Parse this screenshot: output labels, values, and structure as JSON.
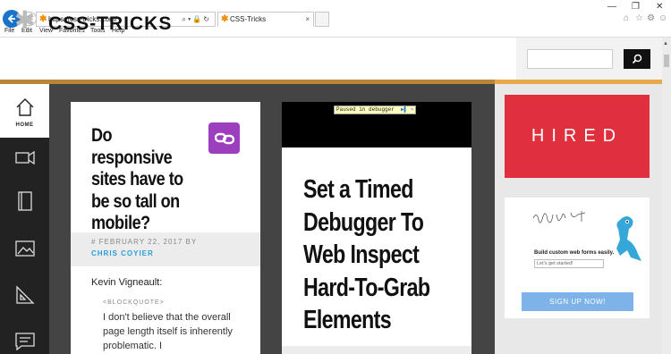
{
  "browser": {
    "url": "https://css-tricks.com/",
    "tab_title": "CSS-Tricks",
    "tab_close": "×",
    "menu": [
      "File",
      "Edit",
      "View",
      "Favorites",
      "Tools",
      "Help"
    ]
  },
  "site": {
    "title": "CSS-TRICKS",
    "home_label": "HOME",
    "search_placeholder": ""
  },
  "card1": {
    "title": "Do responsive sites have to be so tall on mobile?",
    "date": "# FEBRUARY 22, 2017 BY",
    "author": "CHRIS COYIER",
    "quote_author": "Kevin Vigneault:",
    "blockquote_tag": "<BLOCKQUOTE>",
    "blockquote_text": "I don't believe that the overall page length itself is inherently problematic. I"
  },
  "card2": {
    "debugger_badge": "Paused in debugger",
    "title_lines": [
      "Set a Timed",
      "Debugger To",
      "Web Inspect",
      "Hard-To-Grab",
      "Elements"
    ]
  },
  "ads": {
    "hired": "HIRED",
    "form_text": "Build custom web forms easily.",
    "form_input": "Let's get started!",
    "form_button": "SIGN UP NOW!"
  },
  "colors": {
    "accent_orange": "#b7843a",
    "hired_red": "#e0303d",
    "link_blue": "#2a9fd6",
    "badge_purple": "#9b3fbf"
  }
}
